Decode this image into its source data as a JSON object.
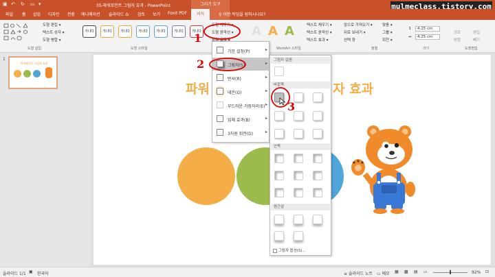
{
  "titlebar": {
    "title": "35-파워포인트 그림자 효과 - PowerPoint",
    "context_title": "그리기 도구"
  },
  "watermark": "mulmeclass.tistory.com",
  "tabs": [
    "파일",
    "홈",
    "삽입",
    "디자인",
    "전환",
    "애니메이션",
    "슬라이드 쇼",
    "검토",
    "보기",
    "Foxit PDF",
    "서식"
  ],
  "tell_me": "어떤 작업을 원하시나요?",
  "ribbon": {
    "insert_group": {
      "label": "도형 삽입",
      "items": [
        "도형 편집 ▾",
        "텍스트 상자 ▾",
        "도형 병합 ▾"
      ]
    },
    "style_group": {
      "label": "도형 스타일",
      "swatch_label": "가나다"
    },
    "fill_buttons": [
      "도형 채우기 ▾",
      "도형 윤곽선 ▾",
      "도형 효과 ▾"
    ],
    "wordart": {
      "label": "WordArt 스타일",
      "items": [
        "텍스트 채우기 ▾",
        "텍스트 윤곽선 ▾",
        "텍스트 효과 ▾"
      ]
    },
    "arrange": {
      "label": "정렬",
      "items": [
        "앞으로 가져오기 ▾",
        "뒤로 보내기 ▾",
        "선택 창",
        "맞춤 ▾",
        "그룹 ▾",
        "회전 ▾"
      ]
    },
    "size": {
      "label": "크기",
      "height": "4.25 cm",
      "width": "4.25 cm"
    },
    "image_edit": {
      "label": "도형편집",
      "items": [
        "경로",
        "편집",
        "병합",
        "빼기"
      ]
    }
  },
  "thumb": {
    "num": "1",
    "title": "파워포인트 그림자 효과"
  },
  "slide": {
    "title_left": "파워",
    "title_right": "자 효과"
  },
  "effects_menu": [
    {
      "label": "기본 설정(P)"
    },
    {
      "label": "그림자(S)"
    },
    {
      "label": "반사(R)"
    },
    {
      "label": "네온(G)"
    },
    {
      "label": "부드러운 가장자리(E)"
    },
    {
      "label": "입체 효과(B)"
    },
    {
      "label": "3차원 회전(D)"
    }
  ],
  "shadow_submenu": {
    "no_shadow": "그림자 없음",
    "outer": "바깥쪽",
    "inner": "안쪽",
    "perspective": "원근감",
    "options": "그림자 옵션(S)..."
  },
  "annotations": [
    "1",
    "2",
    "3"
  ],
  "statusbar": {
    "slide_info": "슬라이드 1/1",
    "lang": "한국어",
    "notes": "슬라이드 노트",
    "comments": "메모",
    "zoom": "92%"
  },
  "colors": {
    "accent": "#c9512a",
    "circle_orange": "#f5ad47",
    "circle_green": "#9bbb4c",
    "circle_blue": "#4fa6d8",
    "annotation": "#dd0000"
  }
}
